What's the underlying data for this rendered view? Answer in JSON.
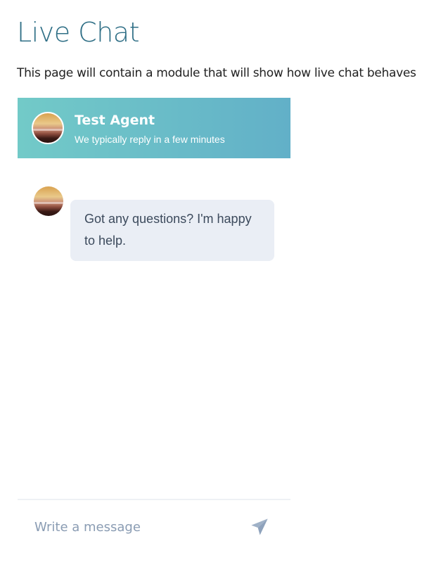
{
  "page": {
    "title": "Live Chat",
    "intro": "This page will contain a module that will show how live chat behaves"
  },
  "chat": {
    "agent_name": "Test Agent",
    "agent_status": "We typically reply in a few minutes",
    "header_gradient": [
      "#72cac8",
      "#62b0c8"
    ],
    "messages": [
      {
        "sender": "agent",
        "text": "Got any questions? I'm happy to help."
      }
    ],
    "composer": {
      "placeholder": "Write a message",
      "send_icon": "paper-plane-icon"
    }
  }
}
